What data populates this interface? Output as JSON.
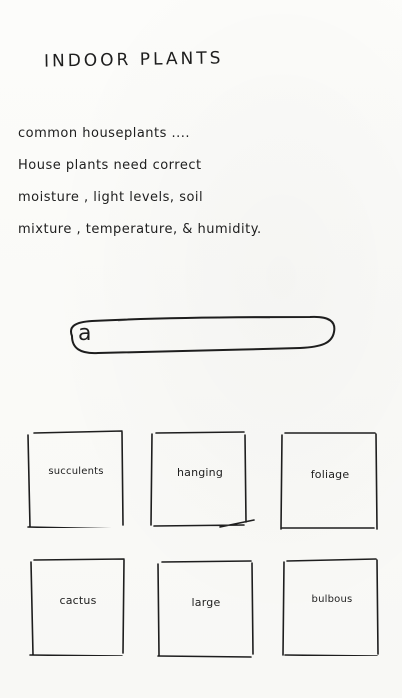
{
  "header": {
    "title": "INDOOR PLANTS"
  },
  "intro": {
    "lines": [
      "common houseplants ....",
      "House plants need correct",
      "moisture , light levels, soil",
      "mixture , temperature, & humidity."
    ]
  },
  "search": {
    "icon": "search-icon",
    "icon_glyph": "a",
    "value": "",
    "placeholder": ""
  },
  "categories": [
    {
      "label": "succulents"
    },
    {
      "label": "hanging"
    },
    {
      "label": "foliage"
    },
    {
      "label": "cactus"
    },
    {
      "label": "large"
    },
    {
      "label": "bulbous"
    }
  ],
  "colors": {
    "ink": "#1e1e1e",
    "paper": "#fbfbf9"
  }
}
